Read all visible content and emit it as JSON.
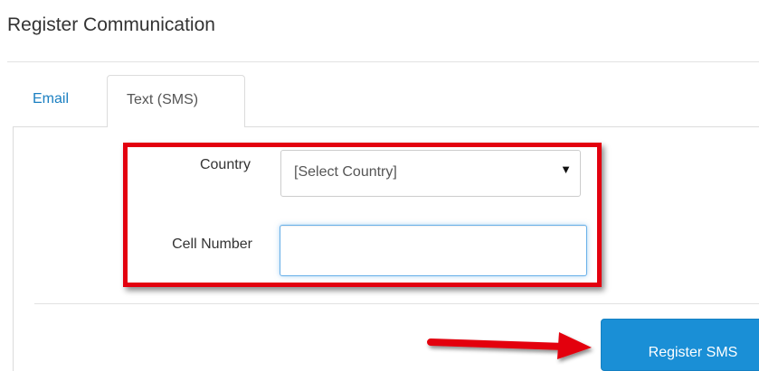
{
  "header": {
    "title": "Register Communication"
  },
  "tabs": [
    {
      "label": "Email",
      "active": false
    },
    {
      "label": "Text (SMS)",
      "active": true
    }
  ],
  "form": {
    "country": {
      "label": "Country",
      "selected_value": "[Select Country]",
      "arrow_glyph": "▼"
    },
    "cell_number": {
      "label": "Cell Number",
      "value": ""
    },
    "submit_label": "Register SMS"
  },
  "annotations": {
    "highlight_color": "#e3000f",
    "arrow_color": "#e3000f"
  },
  "colors": {
    "accent": "#1a8fd6",
    "link": "#1a7fc1"
  }
}
